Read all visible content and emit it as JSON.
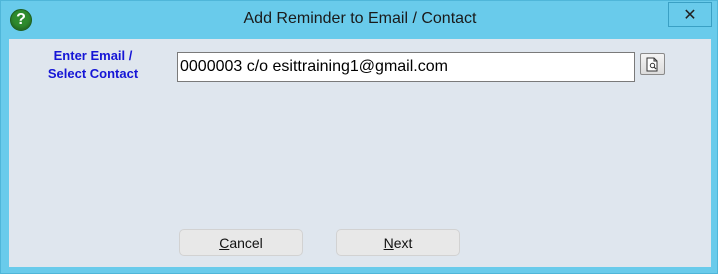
{
  "window": {
    "title": "Add Reminder to Email / Contact",
    "help_icon": "question-mark",
    "close_glyph": "✕"
  },
  "form": {
    "label_line1": "Enter Email /",
    "label_line2": "Select Contact",
    "email_value": "0000003 c/o esittraining1@gmail.com",
    "lookup_icon": "document-search-icon"
  },
  "buttons": {
    "cancel_mnemonic": "C",
    "cancel_rest": "ancel",
    "next_mnemonic": "N",
    "next_rest": "ext"
  },
  "colors": {
    "titlebar": "#69cbeb",
    "client_bg": "#dfe6ee",
    "label_text": "#1515d6"
  }
}
